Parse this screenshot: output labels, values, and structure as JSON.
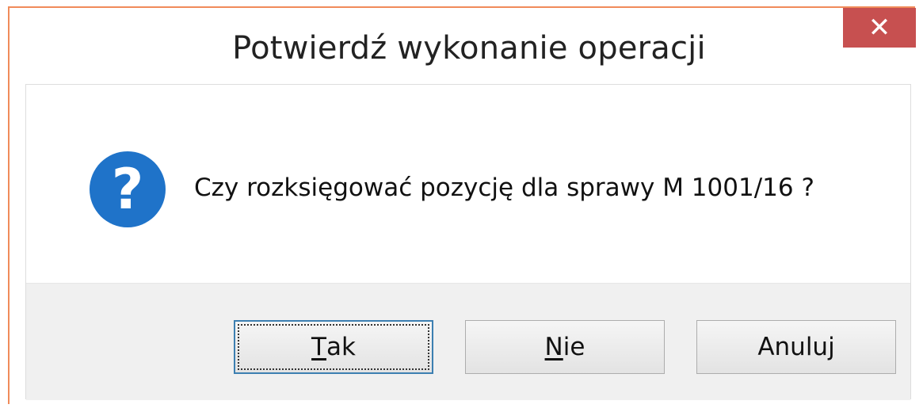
{
  "dialog": {
    "title": "Potwierdź wykonanie operacji",
    "close_symbol": "✕",
    "icon": "question-icon",
    "icon_glyph": "?",
    "message": "Czy rozksięgować pozycję dla sprawy M 1001/16 ?"
  },
  "buttons": {
    "tak": {
      "accel": "T",
      "rest": "ak"
    },
    "nie": {
      "accel": "N",
      "rest": "ie"
    },
    "anuluj": {
      "label": "Anuluj"
    }
  },
  "colors": {
    "close_button": "#c75050",
    "icon_blue": "#1f73c9",
    "frame_border": "#f08b5a",
    "button_area": "#f0f0f0"
  }
}
